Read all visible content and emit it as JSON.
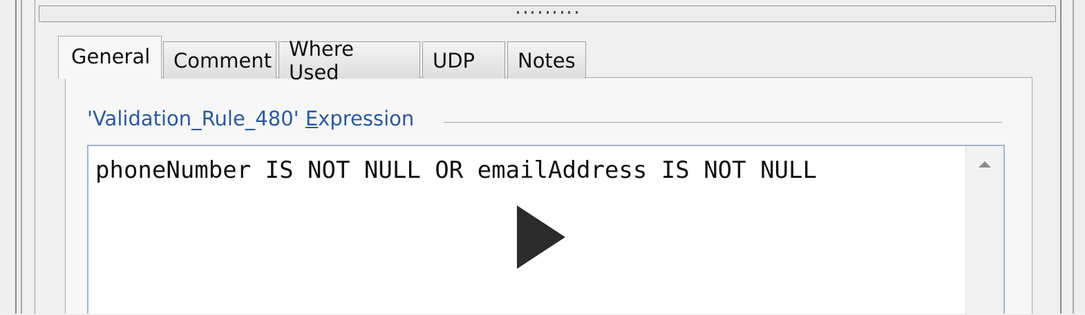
{
  "tabs": [
    {
      "label": "General",
      "active": true
    },
    {
      "label": "Comment",
      "active": false
    },
    {
      "label": "Where Used",
      "active": false
    },
    {
      "label": "UDP",
      "active": false
    },
    {
      "label": "Notes",
      "active": false
    }
  ],
  "expression": {
    "group_title_prefix": "'Validation_Rule_480' ",
    "group_title_mnemonic": "E",
    "group_title_rest": "xpression",
    "text": "phoneNumber IS NOT NULL OR emailAddress IS NOT NULL"
  },
  "icons": {
    "splitter_grip": "grip-dots-icon",
    "scroll_up": "triangle-up-icon",
    "play": "play-icon"
  },
  "colors": {
    "group_title": "#2a5aa0",
    "editor_border": "#9fb4cc",
    "play_overlay": "#2b2b2b"
  }
}
